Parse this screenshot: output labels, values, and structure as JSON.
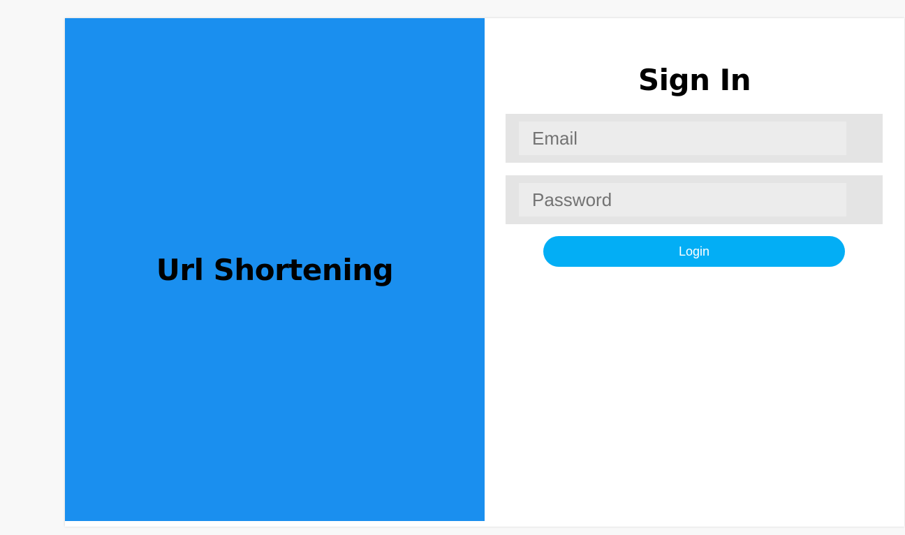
{
  "brand": {
    "title": "Url Shortening"
  },
  "signin": {
    "title": "Sign In",
    "email": {
      "value": "",
      "placeholder": "Email"
    },
    "password": {
      "value": "",
      "placeholder": "Password"
    },
    "login_label": "Login"
  },
  "colors": {
    "brand_panel": "#1a8fef",
    "login_button": "#03aef5",
    "field_outer": "#e4e4e4",
    "field_inner": "#ececec",
    "page_background": "#f8f8f8"
  }
}
